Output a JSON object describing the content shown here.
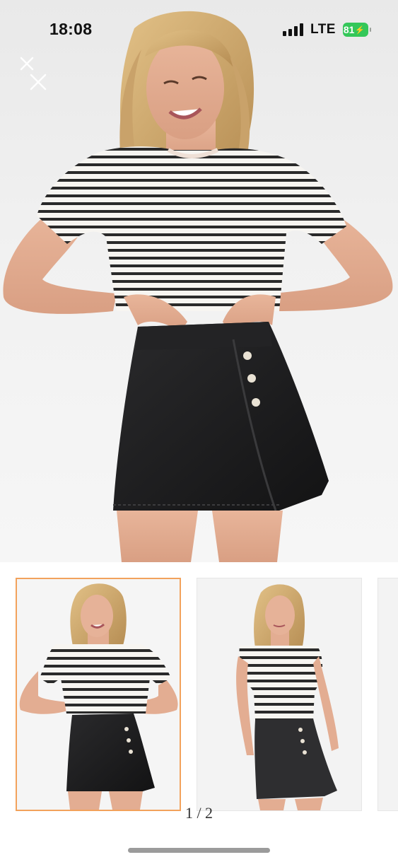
{
  "status_bar": {
    "time": "18:08",
    "network": "LTE",
    "battery_level": "81",
    "battery_color": "#34c759",
    "signal_icon": "cellular-signal-icon",
    "battery_icon": "battery-charging-icon"
  },
  "gallery": {
    "close_icon": "close-icon",
    "page_indicator": "1 / 2",
    "selected_thumbnail": 1,
    "selected_border_color": "#f2a25c",
    "thumbnails": [
      {
        "name": "thumbnail-1"
      },
      {
        "name": "thumbnail-2"
      },
      {
        "name": "thumbnail-3"
      }
    ]
  },
  "colors": {
    "skirt": "#1c1c1e",
    "stripe": "#2a2a2a",
    "background": "#efefef"
  }
}
